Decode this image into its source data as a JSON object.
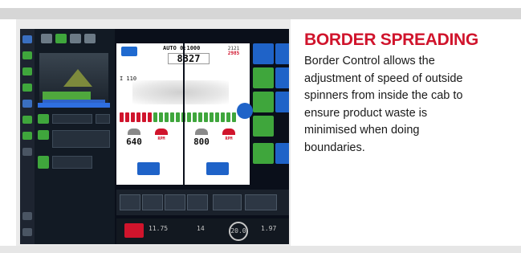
{
  "article": {
    "title": "BORDER SPREADING",
    "body_lines": [
      "Border Control allows the",
      "adjustment of speed of outside",
      "spinners from inside the cab to",
      "ensure product waste is",
      "minimised when doing",
      "boundaries."
    ]
  },
  "terminal": {
    "mode_label": "AUTO",
    "mode_value": "0:1000",
    "target_rate": "8327",
    "right_values": [
      "2121",
      "2985"
    ],
    "width_label": "I 110",
    "spinners": [
      {
        "speed": "640",
        "unit": "RPM",
        "offset": "640"
      },
      {
        "speed": "800",
        "unit": "RPM",
        "offset": "800"
      }
    ],
    "speed_gauge": "20.0",
    "status_values": [
      "11.75",
      "14",
      "1.97"
    ]
  },
  "colors": {
    "brand_red": "#d0142c",
    "terminal_bg": "#0a0f1a",
    "terminal_green": "#3fa63c",
    "terminal_blue": "#1f63c8",
    "band_gray": "#d6d6d6"
  }
}
